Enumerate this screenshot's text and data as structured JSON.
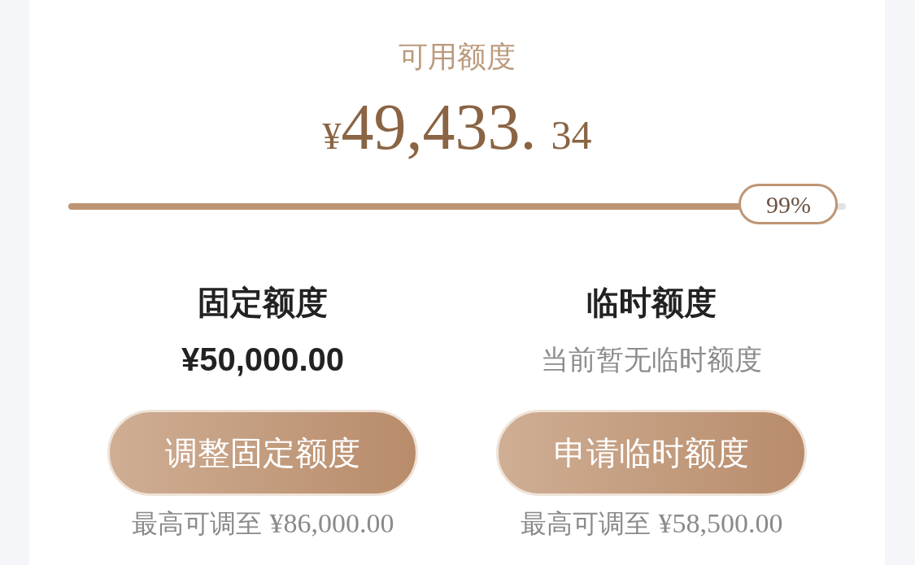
{
  "available": {
    "label": "可用额度",
    "currency": "¥",
    "integer": "49,433.",
    "decimal": "34"
  },
  "progress": {
    "level": 0.99,
    "reading": "99%"
  },
  "limits": [
    {
      "title": "固定额度",
      "kind": "amount",
      "value": "¥50,000.00",
      "button": "调整固定额度",
      "max_label": "最高可调至",
      "max_value": "¥86,000.00"
    },
    {
      "title": "临时额度",
      "kind": "note",
      "value": "当前暂无临时额度",
      "button": "申请临时额度",
      "max_label": "最高可调至",
      "max_value": "¥58,500.00"
    }
  ]
}
